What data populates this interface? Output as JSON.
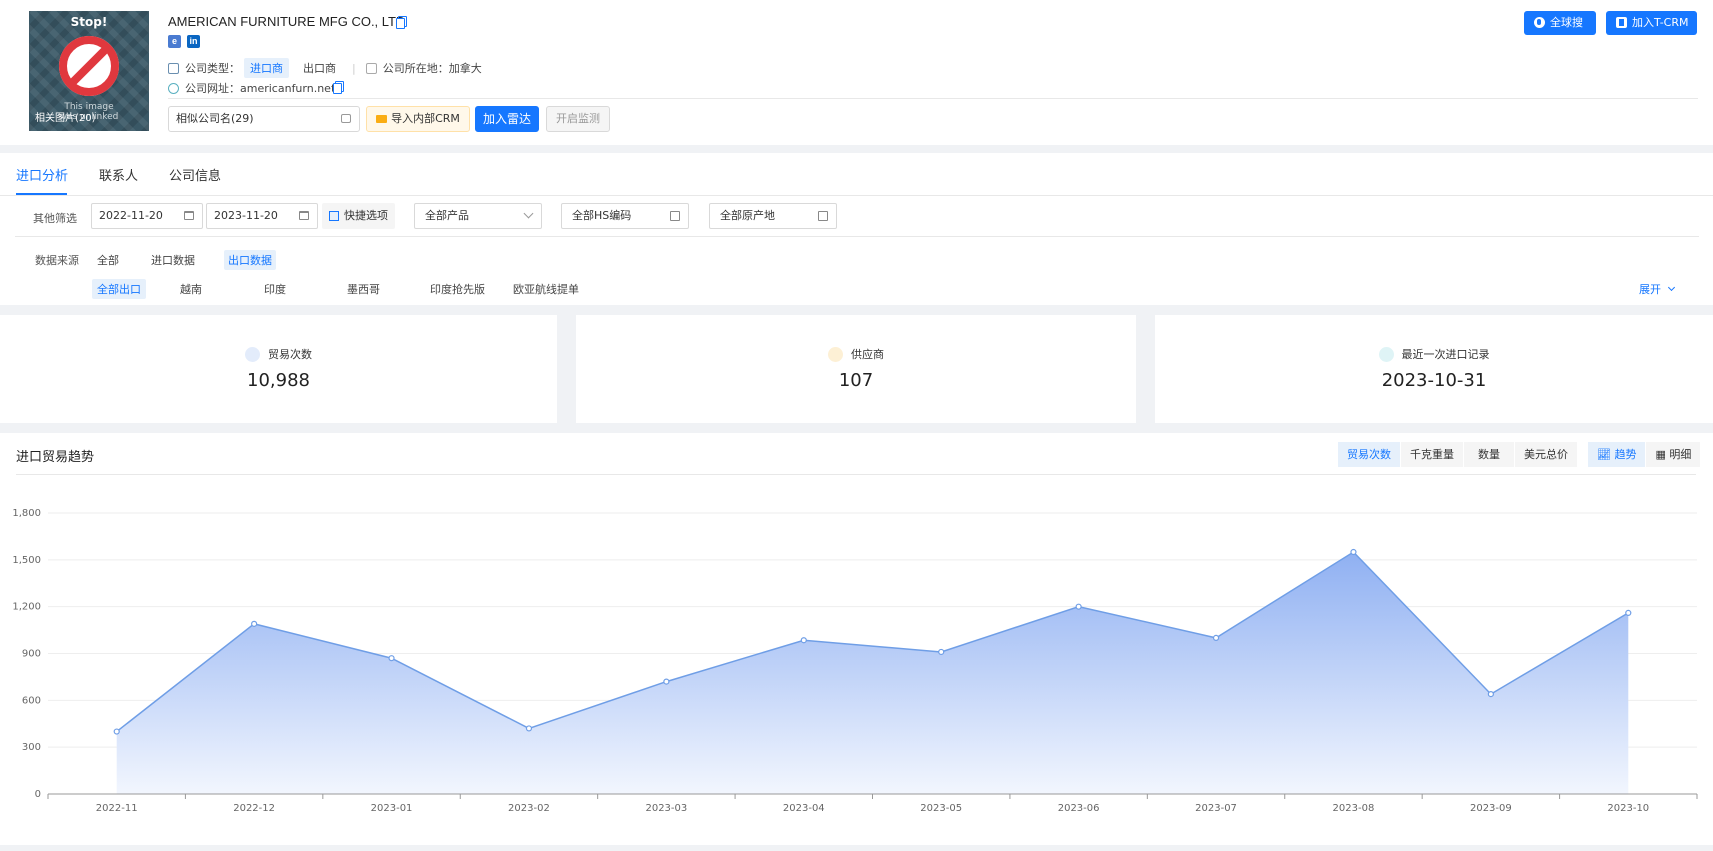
{
  "company": {
    "name": "AMERICAN FURNITURE MFG CO., LTD",
    "logo_text": "Stop!",
    "logo_note": "This image\nwas unlinked",
    "related_images": "相关图片(20)",
    "type_label": "公司类型：",
    "type_options": [
      "进口商",
      "出口商"
    ],
    "location_label": "公司所在地：",
    "location": "加拿大",
    "website_label": "公司网址：",
    "website": "americanfurn.net",
    "similar_names": "相似公司名(29)",
    "import_crm": "导入内部CRM",
    "add_radar": "加入雷达",
    "enable_monitor": "开启监测",
    "global_search": "全球搜",
    "add_tcrm": "加入T-CRM"
  },
  "tabs": [
    "进口分析",
    "联系人",
    "公司信息"
  ],
  "filters": {
    "label": "其他筛选",
    "date_from": "2022-11-20",
    "date_to": "2023-11-20",
    "quick_options": "快捷选项",
    "product": "全部产品",
    "hs_code": "全部HS编码",
    "origin": "全部原产地",
    "source_label": "数据来源",
    "sources": [
      "全部",
      "进口数据",
      "出口数据"
    ],
    "sub_sources": [
      "全部出口",
      "越南",
      "印度",
      "墨西哥",
      "印度抢先版",
      "欧亚航线提单"
    ],
    "expand": "展开"
  },
  "stats": [
    {
      "label": "贸易次数",
      "value": "10,988"
    },
    {
      "label": "供应商",
      "value": "107"
    },
    {
      "label": "最近一次进口记录",
      "value": "2023-10-31"
    }
  ],
  "chart_panel": {
    "title": "进口贸易趋势",
    "metrics": [
      "贸易次数",
      "千克重量",
      "数量",
      "美元总价"
    ],
    "views": [
      "趋势",
      "明细"
    ]
  },
  "colors": {
    "primary": "#1677ff",
    "line": "#6f9ee6",
    "area_top": "#8fb0f2",
    "area_bottom": "#f2f6fe"
  },
  "chart_data": {
    "type": "area",
    "x": [
      "2022-11",
      "2022-12",
      "2023-01",
      "2023-02",
      "2023-03",
      "2023-04",
      "2023-05",
      "2023-06",
      "2023-07",
      "2023-08",
      "2023-09",
      "2023-10"
    ],
    "series": [
      {
        "values": [
          400,
          1090,
          870,
          420,
          720,
          985,
          910,
          1200,
          1000,
          1550,
          640,
          1160
        ]
      }
    ],
    "yticks": [
      "0",
      "300",
      "600",
      "900",
      "1,200",
      "1,500",
      "1,800"
    ],
    "ylim": [
      0,
      1800
    ],
    "grid": true,
    "legend": "none"
  }
}
